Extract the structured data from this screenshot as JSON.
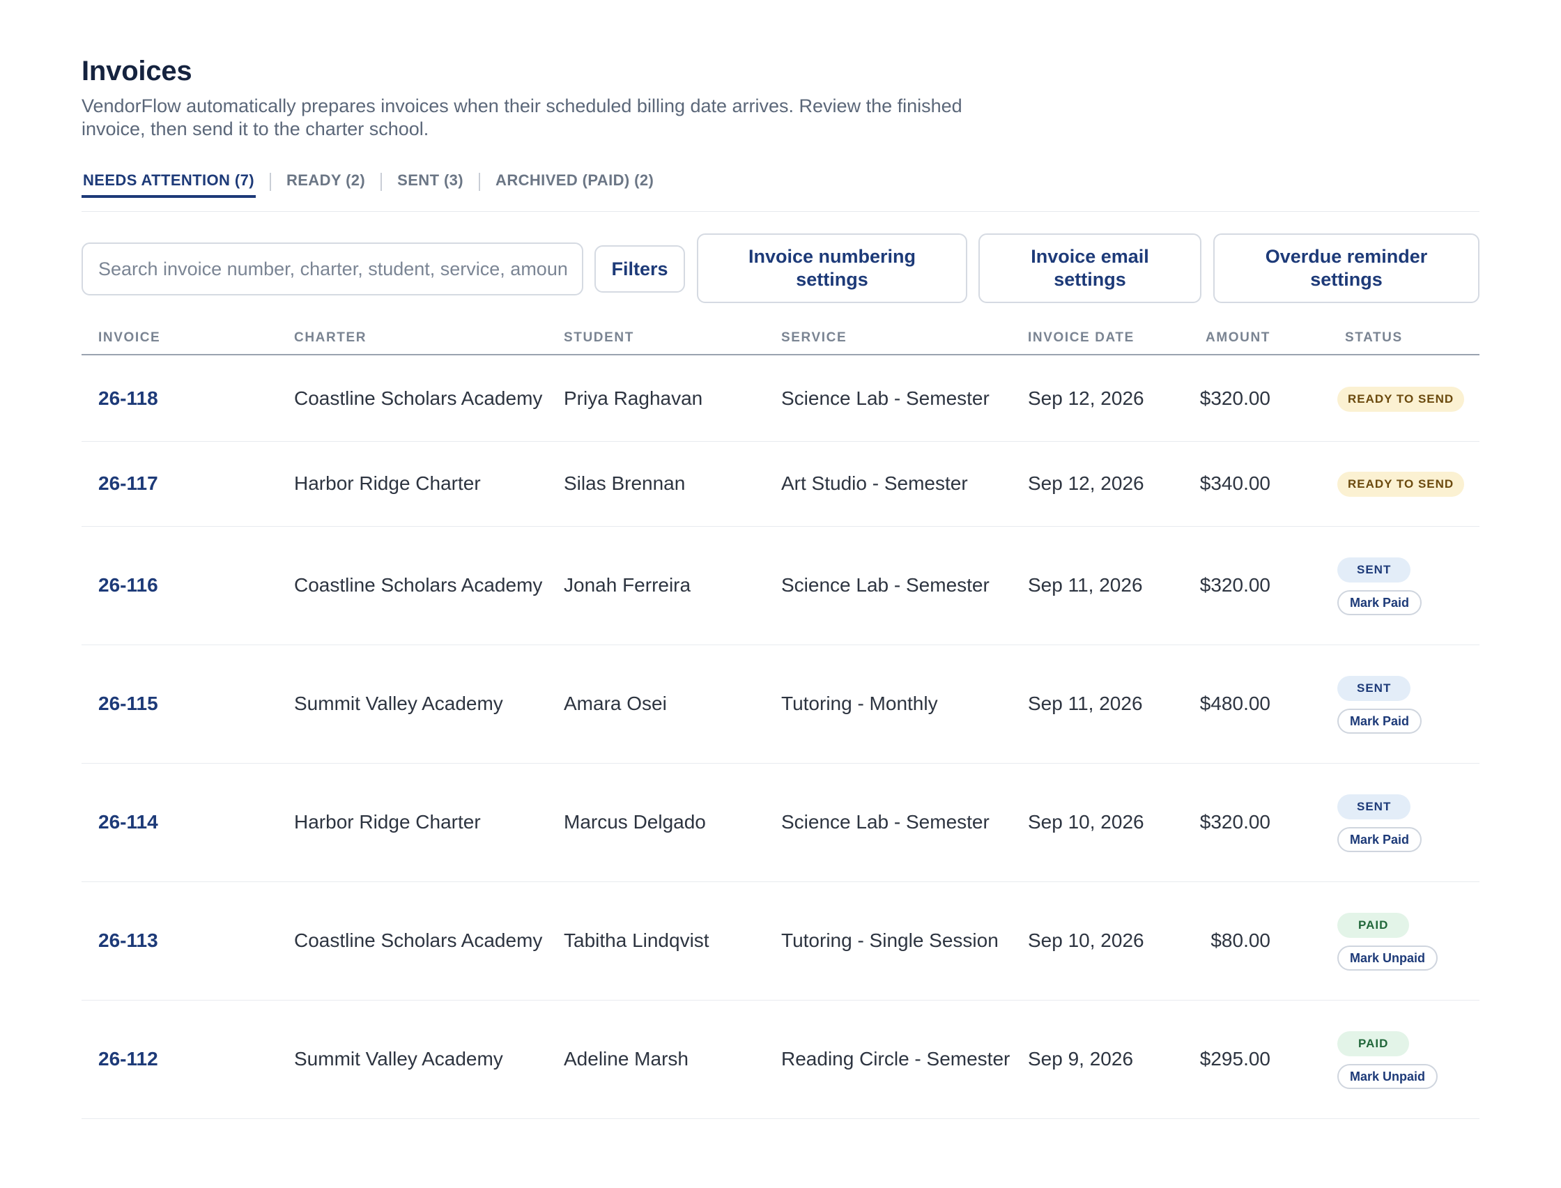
{
  "header": {
    "title": "Invoices",
    "subtitle": "VendorFlow automatically prepares invoices when their scheduled billing date arrives. Review the finished invoice, then send it to the charter school."
  },
  "tabs": [
    {
      "label": "NEEDS ATTENTION (7)",
      "active": true
    },
    {
      "label": "READY (2)",
      "active": false
    },
    {
      "label": "SENT (3)",
      "active": false
    },
    {
      "label": "ARCHIVED (PAID) (2)",
      "active": false
    }
  ],
  "toolbar": {
    "search_placeholder": "Search invoice number, charter, student, service, amount",
    "filters_label": "Filters",
    "numbering_label": "Invoice numbering settings",
    "email_label": "Invoice email settings",
    "overdue_label": "Overdue reminder settings"
  },
  "table": {
    "columns": {
      "invoice": "INVOICE",
      "charter": "CHARTER",
      "student": "STUDENT",
      "service": "SERVICE",
      "date": "INVOICE DATE",
      "amount": "AMOUNT",
      "status": "STATUS"
    },
    "rows": [
      {
        "invoice": "26-118",
        "charter": "Coastline Scholars Academy",
        "student": "Priya Raghavan",
        "service": "Science Lab - Semester",
        "date": "Sep 12, 2026",
        "amount": "$320.00",
        "status": "READY TO SEND",
        "action": ""
      },
      {
        "invoice": "26-117",
        "charter": "Harbor Ridge Charter",
        "student": "Silas Brennan",
        "service": "Art Studio - Semester",
        "date": "Sep 12, 2026",
        "amount": "$340.00",
        "status": "READY TO SEND",
        "action": ""
      },
      {
        "invoice": "26-116",
        "charter": "Coastline Scholars Academy",
        "student": "Jonah Ferreira",
        "service": "Science Lab - Semester",
        "date": "Sep 11, 2026",
        "amount": "$320.00",
        "status": "SENT",
        "action": "Mark Paid"
      },
      {
        "invoice": "26-115",
        "charter": "Summit Valley Academy",
        "student": "Amara Osei",
        "service": "Tutoring - Monthly",
        "date": "Sep 11, 2026",
        "amount": "$480.00",
        "status": "SENT",
        "action": "Mark Paid"
      },
      {
        "invoice": "26-114",
        "charter": "Harbor Ridge Charter",
        "student": "Marcus Delgado",
        "service": "Science Lab - Semester",
        "date": "Sep 10, 2026",
        "amount": "$320.00",
        "status": "SENT",
        "action": "Mark Paid"
      },
      {
        "invoice": "26-113",
        "charter": "Coastline Scholars Academy",
        "student": "Tabitha Lindqvist",
        "service": "Tutoring - Single Session",
        "date": "Sep 10, 2026",
        "amount": "$80.00",
        "status": "PAID",
        "action": "Mark Unpaid"
      },
      {
        "invoice": "26-112",
        "charter": "Summit Valley Academy",
        "student": "Adeline Marsh",
        "service": "Reading Circle - Semester",
        "date": "Sep 9, 2026",
        "amount": "$295.00",
        "status": "PAID",
        "action": "Mark Unpaid"
      }
    ]
  },
  "colors": {
    "accent": "#1d3a78",
    "ready_bg": "#fbf1d2",
    "sent_bg": "#e3edf8",
    "paid_bg": "#e3f4e8"
  }
}
